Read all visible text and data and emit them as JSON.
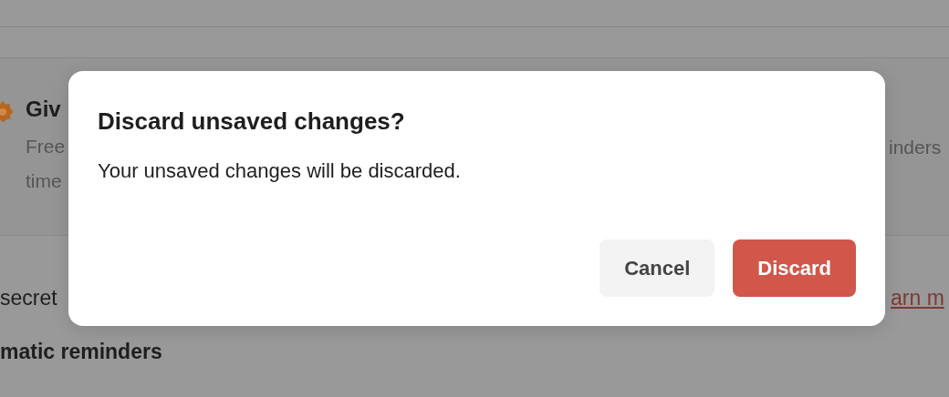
{
  "background": {
    "card": {
      "title": "Giv",
      "description_lines": [
        "Free",
        "time"
      ],
      "description_right": "inders"
    },
    "setting_row": {
      "text": "secret",
      "link": "arn m"
    },
    "section_heading": "matic reminders"
  },
  "dialog": {
    "title": "Discard unsaved changes?",
    "message": "Your unsaved changes will be discarded.",
    "buttons": [
      {
        "label": "Cancel",
        "kind": "secondary"
      },
      {
        "label": "Discard",
        "kind": "destructive"
      }
    ]
  }
}
